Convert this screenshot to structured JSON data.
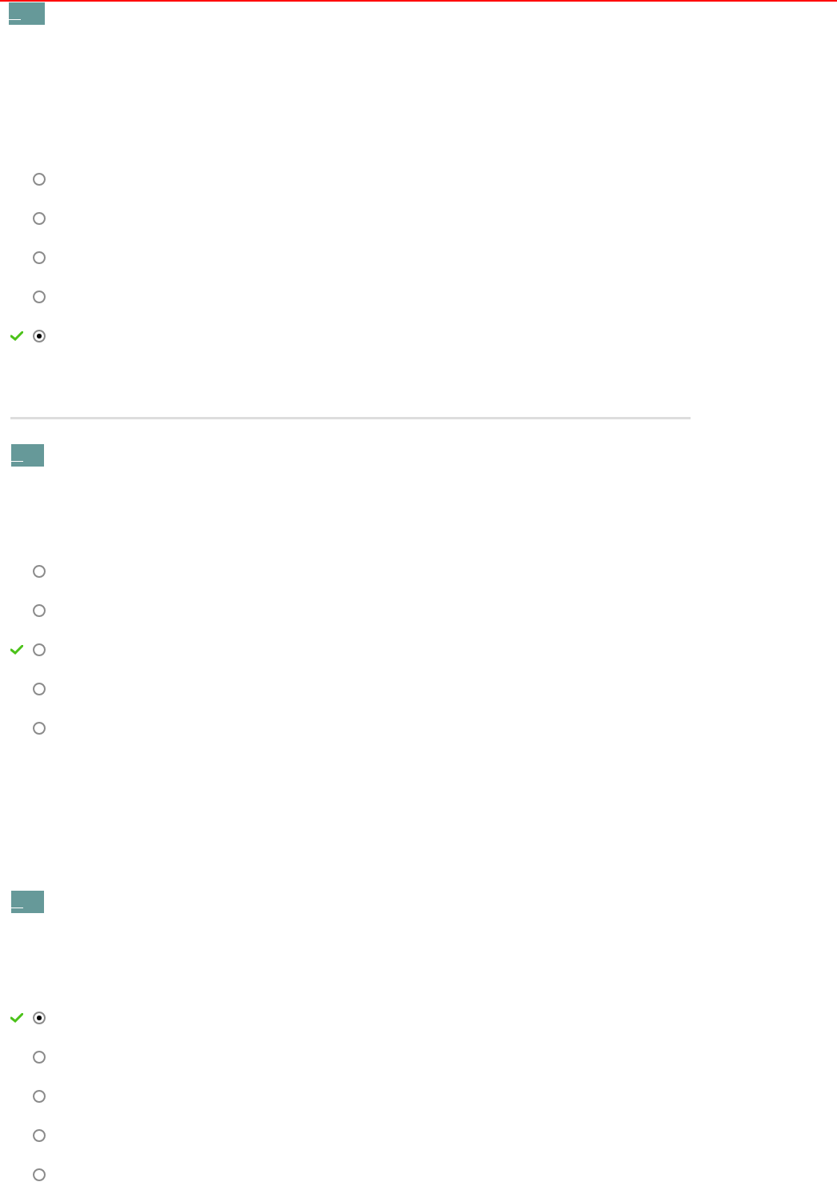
{
  "questions": [
    {
      "divider_after": true,
      "options": [
        {
          "selected": false,
          "correct": false
        },
        {
          "selected": false,
          "correct": false
        },
        {
          "selected": false,
          "correct": false
        },
        {
          "selected": false,
          "correct": false
        },
        {
          "selected": true,
          "correct": true
        }
      ]
    },
    {
      "divider_after": false,
      "options": [
        {
          "selected": false,
          "correct": false
        },
        {
          "selected": false,
          "correct": false
        },
        {
          "selected": false,
          "correct": true
        },
        {
          "selected": false,
          "correct": false
        },
        {
          "selected": false,
          "correct": false
        }
      ]
    },
    {
      "divider_after": false,
      "options": [
        {
          "selected": true,
          "correct": true
        },
        {
          "selected": false,
          "correct": false
        },
        {
          "selected": false,
          "correct": false
        },
        {
          "selected": false,
          "correct": false
        },
        {
          "selected": false,
          "correct": false
        }
      ]
    }
  ]
}
